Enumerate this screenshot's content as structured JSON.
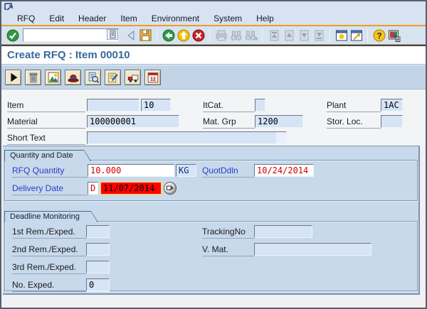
{
  "menu_bar": {
    "items": [
      "RFQ",
      "Edit",
      "Header",
      "Item",
      "Environment",
      "System",
      "Help"
    ]
  },
  "toolbar": {
    "command_value": "",
    "icons": [
      "enter",
      "command-field-dropdown",
      "hide-command-field",
      "save",
      "back",
      "exit",
      "cancel",
      "print",
      "find",
      "find-next",
      "first-page",
      "previous-page",
      "next-page",
      "last-page",
      "new-session",
      "create-shortcut",
      "help",
      "customize-layout"
    ]
  },
  "title": {
    "text": "Create RFQ : Item 00010"
  },
  "app_toolbar": {
    "icons": [
      "next-item",
      "delete",
      "overview",
      "header-details",
      "item-details",
      "texts",
      "delivery-address",
      "delivery-schedule"
    ]
  },
  "header_fields": {
    "item": {
      "label": "Item",
      "doc": "",
      "no": "10"
    },
    "itcat": {
      "label": "ItCat.",
      "value": ""
    },
    "plant": {
      "label": "Plant",
      "value": "1AC"
    },
    "material": {
      "label": "Material",
      "value": "100000001"
    },
    "mat_grp": {
      "label": "Mat. Grp",
      "value": "1200"
    },
    "stor_loc": {
      "label": "Stor. Loc.",
      "value": ""
    },
    "short_text": {
      "label": "Short Text",
      "value": ""
    }
  },
  "quantity_and_date": {
    "title": "Quantity and Date",
    "rfq_quantity": {
      "label": "RFQ Quantity",
      "value": "10.000",
      "unit": "KG"
    },
    "quot_ddln": {
      "label": "QuotDdln",
      "value": "10/24/2014"
    },
    "delivery_date": {
      "label": "Delivery Date",
      "category": "D",
      "value": "11/07/2014"
    }
  },
  "deadline_monitoring": {
    "title": "Deadline Monitoring",
    "rem1": {
      "label": "1st Rem./Exped.",
      "value": ""
    },
    "rem2": {
      "label": "2nd Rem./Exped.",
      "value": ""
    },
    "rem3": {
      "label": "3rd Rem./Exped.",
      "value": ""
    },
    "no_exped": {
      "label": "No. Exped.",
      "value": "0"
    },
    "tracking_no": {
      "label": "TrackingNo",
      "value": ""
    },
    "v_mat": {
      "label": "V. Mat.",
      "value": ""
    }
  },
  "colors": {
    "accent_orange": "#ef9b23",
    "title_blue": "#356a9c",
    "label_blue": "#2b3cc4",
    "value_red": "#d40000",
    "focus_field_bg": "#fe0000",
    "chrome_blue": "#d7e3f1",
    "panel_blue": "#c8d9ec"
  }
}
